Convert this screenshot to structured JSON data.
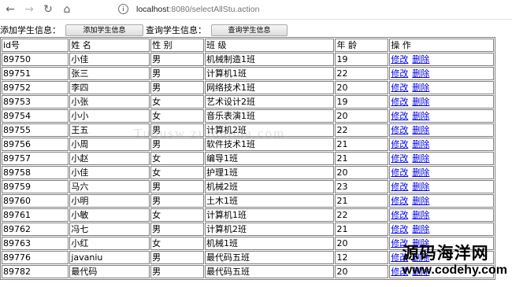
{
  "browser": {
    "url_host": "localhost",
    "url_path": ":8080/selectAllStu.action"
  },
  "form": {
    "add_label": "添加学生信息：",
    "add_button": "添加学生信息",
    "query_label": "查询学生信息：",
    "query_button": "查询学生信息"
  },
  "table": {
    "headers": [
      "id号",
      "姓 名",
      "性 别",
      "班 级",
      "年 龄",
      "操 作"
    ],
    "edit_label": "修改",
    "delete_label": "删除",
    "rows": [
      {
        "id": "89750",
        "name": "小佳",
        "gender": "男",
        "class": "机械制造1班",
        "age": "19"
      },
      {
        "id": "89751",
        "name": "张三",
        "gender": "男",
        "class": "计算机1班",
        "age": "22"
      },
      {
        "id": "89752",
        "name": "李四",
        "gender": "男",
        "class": "网络技术1班",
        "age": "20"
      },
      {
        "id": "89753",
        "name": "小张",
        "gender": "女",
        "class": "艺术设计2班",
        "age": "19"
      },
      {
        "id": "89754",
        "name": "小小",
        "gender": "女",
        "class": "音乐表演1班",
        "age": "20"
      },
      {
        "id": "89755",
        "name": "王五",
        "gender": "男",
        "class": "计算机2班",
        "age": "22"
      },
      {
        "id": "89756",
        "name": "小周",
        "gender": "男",
        "class": "软件技术1班",
        "age": "21"
      },
      {
        "id": "89757",
        "name": "小赵",
        "gender": "女",
        "class": "编导1班",
        "age": "21"
      },
      {
        "id": "89758",
        "name": "小佳",
        "gender": "女",
        "class": "护理1班",
        "age": "20"
      },
      {
        "id": "89759",
        "name": "马六",
        "gender": "男",
        "class": "机械2班",
        "age": "23"
      },
      {
        "id": "89760",
        "name": "小明",
        "gender": "男",
        "class": "土木1班",
        "age": "21"
      },
      {
        "id": "89761",
        "name": "小敏",
        "gender": "女",
        "class": "计算机1班",
        "age": "22"
      },
      {
        "id": "89762",
        "name": "冯七",
        "gender": "男",
        "class": "计算机2班",
        "age": "21"
      },
      {
        "id": "89763",
        "name": "小红",
        "gender": "女",
        "class": "机械1班",
        "age": "20"
      },
      {
        "id": "89776",
        "name": "javaniu",
        "gender": "男",
        "class": "最代码五班",
        "age": "12"
      },
      {
        "id": "89782",
        "name": "最代码",
        "gender": "男",
        "class": "最代码五班",
        "age": "20"
      }
    ]
  },
  "overlays": {
    "watermark": "Tudusw     zuidaima.com",
    "logo_cn": "源码海洋网",
    "logo_en": "www.codehy.com"
  },
  "colors": {
    "link": "#0000ee",
    "border": "#808080"
  }
}
